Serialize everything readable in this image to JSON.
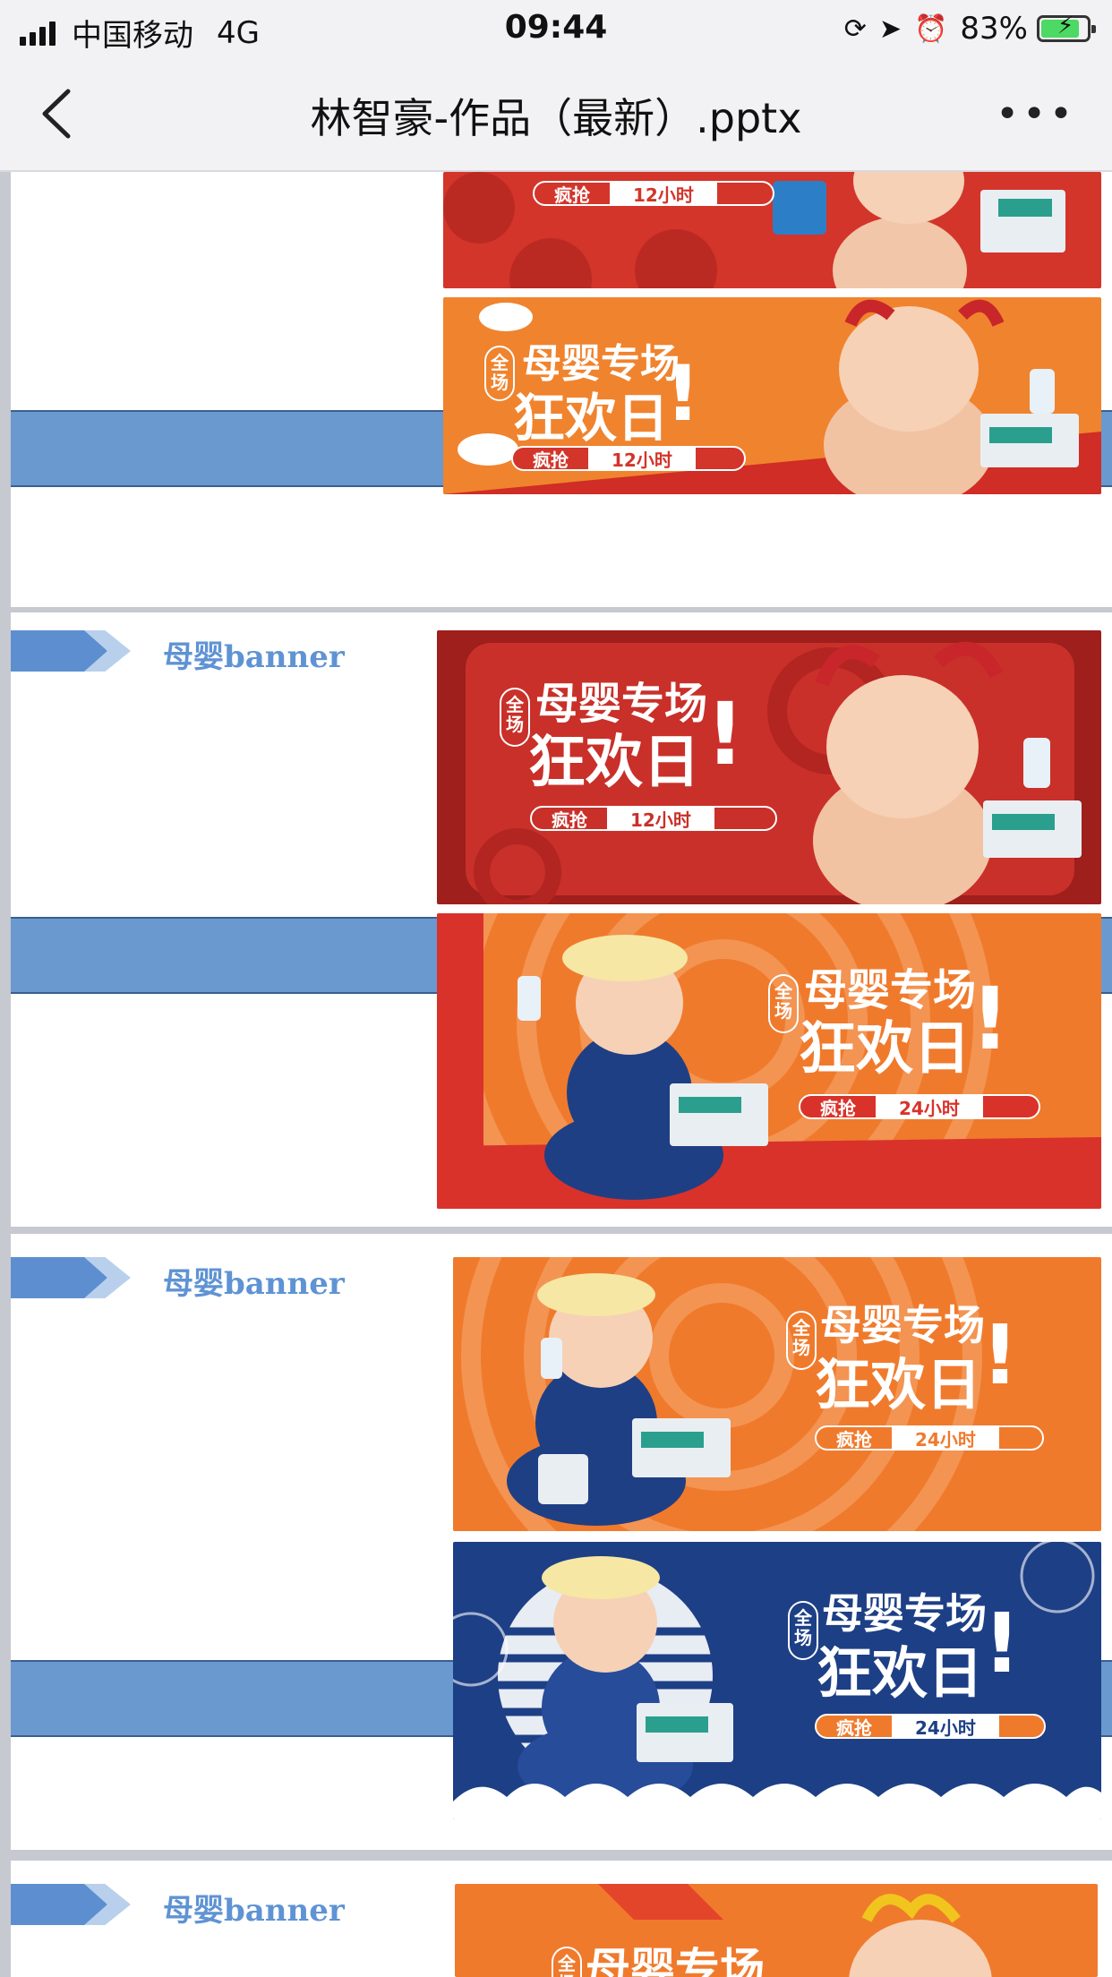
{
  "status_bar": {
    "carrier": "中国移动",
    "network": "4G",
    "time": "09:44",
    "battery": "83%"
  },
  "nav": {
    "title": "林智豪-作品（最新）.pptx",
    "more": "•••"
  },
  "slides": [
    {
      "label": "母婴banner"
    },
    {
      "label": "母婴banner"
    },
    {
      "label": "母婴banner"
    }
  ],
  "banner_text": {
    "badge": "全场",
    "headline_1": "母婴专场",
    "headline_2": "狂欢日",
    "exclaim": "!",
    "tag_left": "疯抢",
    "tag_12h": "12小时",
    "tag_24h": "24小时"
  },
  "colors": {
    "red": "#d3352a",
    "orange": "#f0832e",
    "navy": "#1d3f86",
    "stripe": "#6a99d0",
    "label": "#5f93d3"
  }
}
